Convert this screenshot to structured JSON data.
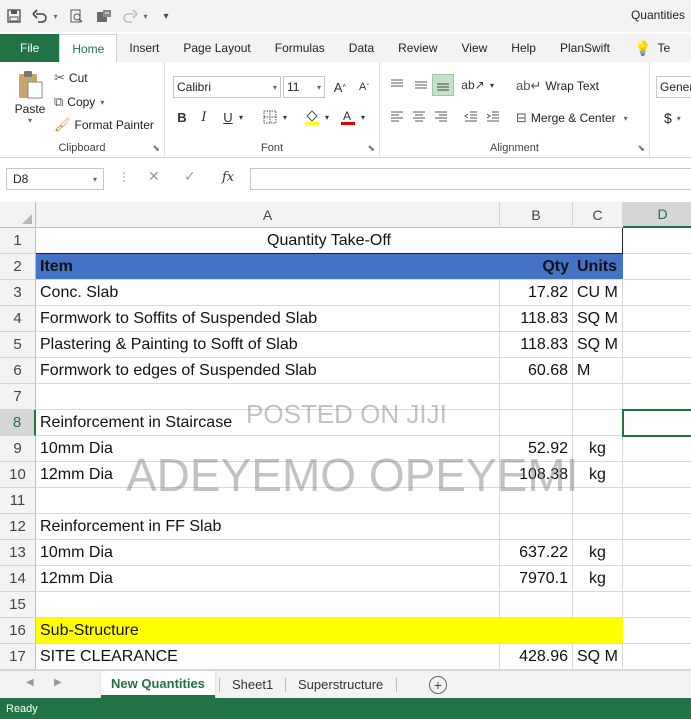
{
  "window": {
    "title": "Quantities"
  },
  "qat": {
    "save": "💾",
    "undo": "↶",
    "redo": "↷"
  },
  "tabs": {
    "file": "File",
    "home": "Home",
    "insert": "Insert",
    "page_layout": "Page Layout",
    "formulas": "Formulas",
    "data": "Data",
    "review": "Review",
    "view": "View",
    "help": "Help",
    "planswift": "PlanSwift",
    "tell": "Te"
  },
  "clipboard": {
    "paste": "Paste",
    "cut": "Cut",
    "copy": "Copy",
    "format_painter": "Format Painter",
    "label": "Clipboard"
  },
  "font": {
    "name": "Calibri",
    "size": "11",
    "label": "Font",
    "bold": "B",
    "italic": "I",
    "underline": "U",
    "grow": "A",
    "shrink": "A"
  },
  "alignment": {
    "wrap_text": "Wrap Text",
    "merge_center": "Merge & Center",
    "label": "Alignment"
  },
  "number": {
    "format": "Gener",
    "currency": "$"
  },
  "formula_bar": {
    "name_box": "D8",
    "fx": "fx",
    "value": ""
  },
  "columns": [
    "A",
    "B",
    "C",
    "D"
  ],
  "rows": [
    {
      "num": "1",
      "a": "Quantity Take-Off",
      "b": "",
      "c": ""
    },
    {
      "num": "2",
      "a": "Item",
      "b": "Qty",
      "c": "Units"
    },
    {
      "num": "3",
      "a": "Conc. Slab",
      "b": "17.82",
      "c": "CU M"
    },
    {
      "num": "4",
      "a": "Formwork to Soffits of Suspended Slab",
      "b": "118.83",
      "c": "SQ M"
    },
    {
      "num": "5",
      "a": "Plastering & Painting to Sofft of Slab",
      "b": "118.83",
      "c": "SQ M"
    },
    {
      "num": "6",
      "a": "Formwork to edges of Suspended Slab",
      "b": "60.68",
      "c": "M"
    },
    {
      "num": "7",
      "a": "",
      "b": "",
      "c": ""
    },
    {
      "num": "8",
      "a": "Reinforcement in Staircase",
      "b": "",
      "c": ""
    },
    {
      "num": "9",
      "a": "10mm Dia",
      "b": "52.92",
      "c": "kg"
    },
    {
      "num": "10",
      "a": "12mm Dia",
      "b": "108.38",
      "c": "kg"
    },
    {
      "num": "11",
      "a": "",
      "b": "",
      "c": ""
    },
    {
      "num": "12",
      "a": "Reinforcement in FF Slab",
      "b": "",
      "c": ""
    },
    {
      "num": "13",
      "a": "10mm Dia",
      "b": "637.22",
      "c": "kg"
    },
    {
      "num": "14",
      "a": "12mm Dia",
      "b": "7970.1",
      "c": "kg"
    },
    {
      "num": "15",
      "a": "",
      "b": "",
      "c": ""
    },
    {
      "num": "16",
      "a": "Sub-Structure",
      "b": "",
      "c": ""
    },
    {
      "num": "17",
      "a": "SITE CLEARANCE",
      "b": "428.96",
      "c": "SQ M"
    }
  ],
  "watermarks": {
    "top": "POSTED ON JIJI",
    "main": "ADEYEMO OPEYEMI"
  },
  "sheets": {
    "s1": "New Quantities",
    "s2": "Sheet1",
    "s3": "Superstructure",
    "add": "+"
  },
  "status": {
    "text": "Ready"
  },
  "colors": {
    "excel_green": "#217346",
    "header_blue": "#4472c4",
    "highlight_yellow": "#ffff00"
  }
}
